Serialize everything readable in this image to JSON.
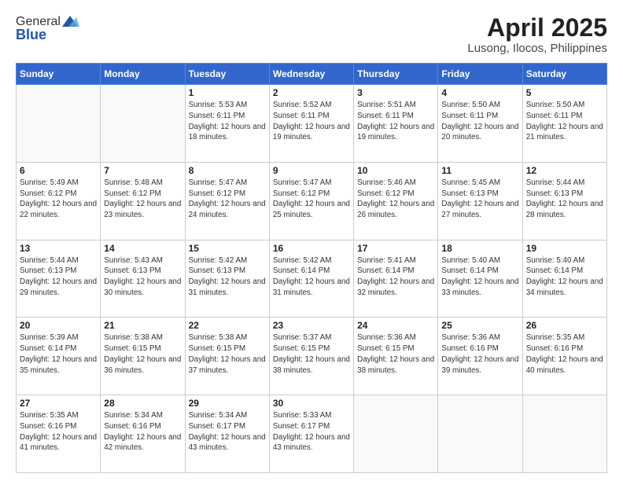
{
  "header": {
    "logo_general": "General",
    "logo_blue": "Blue",
    "title": "April 2025",
    "subtitle": "Lusong, Ilocos, Philippines"
  },
  "weekdays": [
    "Sunday",
    "Monday",
    "Tuesday",
    "Wednesday",
    "Thursday",
    "Friday",
    "Saturday"
  ],
  "weeks": [
    [
      {
        "day": "",
        "info": ""
      },
      {
        "day": "",
        "info": ""
      },
      {
        "day": "1",
        "info": "Sunrise: 5:53 AM\nSunset: 6:11 PM\nDaylight: 12 hours and 18 minutes."
      },
      {
        "day": "2",
        "info": "Sunrise: 5:52 AM\nSunset: 6:11 PM\nDaylight: 12 hours and 19 minutes."
      },
      {
        "day": "3",
        "info": "Sunrise: 5:51 AM\nSunset: 6:11 PM\nDaylight: 12 hours and 19 minutes."
      },
      {
        "day": "4",
        "info": "Sunrise: 5:50 AM\nSunset: 6:11 PM\nDaylight: 12 hours and 20 minutes."
      },
      {
        "day": "5",
        "info": "Sunrise: 5:50 AM\nSunset: 6:11 PM\nDaylight: 12 hours and 21 minutes."
      }
    ],
    [
      {
        "day": "6",
        "info": "Sunrise: 5:49 AM\nSunset: 6:12 PM\nDaylight: 12 hours and 22 minutes."
      },
      {
        "day": "7",
        "info": "Sunrise: 5:48 AM\nSunset: 6:12 PM\nDaylight: 12 hours and 23 minutes."
      },
      {
        "day": "8",
        "info": "Sunrise: 5:47 AM\nSunset: 6:12 PM\nDaylight: 12 hours and 24 minutes."
      },
      {
        "day": "9",
        "info": "Sunrise: 5:47 AM\nSunset: 6:12 PM\nDaylight: 12 hours and 25 minutes."
      },
      {
        "day": "10",
        "info": "Sunrise: 5:46 AM\nSunset: 6:12 PM\nDaylight: 12 hours and 26 minutes."
      },
      {
        "day": "11",
        "info": "Sunrise: 5:45 AM\nSunset: 6:13 PM\nDaylight: 12 hours and 27 minutes."
      },
      {
        "day": "12",
        "info": "Sunrise: 5:44 AM\nSunset: 6:13 PM\nDaylight: 12 hours and 28 minutes."
      }
    ],
    [
      {
        "day": "13",
        "info": "Sunrise: 5:44 AM\nSunset: 6:13 PM\nDaylight: 12 hours and 29 minutes."
      },
      {
        "day": "14",
        "info": "Sunrise: 5:43 AM\nSunset: 6:13 PM\nDaylight: 12 hours and 30 minutes."
      },
      {
        "day": "15",
        "info": "Sunrise: 5:42 AM\nSunset: 6:13 PM\nDaylight: 12 hours and 31 minutes."
      },
      {
        "day": "16",
        "info": "Sunrise: 5:42 AM\nSunset: 6:14 PM\nDaylight: 12 hours and 31 minutes."
      },
      {
        "day": "17",
        "info": "Sunrise: 5:41 AM\nSunset: 6:14 PM\nDaylight: 12 hours and 32 minutes."
      },
      {
        "day": "18",
        "info": "Sunrise: 5:40 AM\nSunset: 6:14 PM\nDaylight: 12 hours and 33 minutes."
      },
      {
        "day": "19",
        "info": "Sunrise: 5:40 AM\nSunset: 6:14 PM\nDaylight: 12 hours and 34 minutes."
      }
    ],
    [
      {
        "day": "20",
        "info": "Sunrise: 5:39 AM\nSunset: 6:14 PM\nDaylight: 12 hours and 35 minutes."
      },
      {
        "day": "21",
        "info": "Sunrise: 5:38 AM\nSunset: 6:15 PM\nDaylight: 12 hours and 36 minutes."
      },
      {
        "day": "22",
        "info": "Sunrise: 5:38 AM\nSunset: 6:15 PM\nDaylight: 12 hours and 37 minutes."
      },
      {
        "day": "23",
        "info": "Sunrise: 5:37 AM\nSunset: 6:15 PM\nDaylight: 12 hours and 38 minutes."
      },
      {
        "day": "24",
        "info": "Sunrise: 5:36 AM\nSunset: 6:15 PM\nDaylight: 12 hours and 38 minutes."
      },
      {
        "day": "25",
        "info": "Sunrise: 5:36 AM\nSunset: 6:16 PM\nDaylight: 12 hours and 39 minutes."
      },
      {
        "day": "26",
        "info": "Sunrise: 5:35 AM\nSunset: 6:16 PM\nDaylight: 12 hours and 40 minutes."
      }
    ],
    [
      {
        "day": "27",
        "info": "Sunrise: 5:35 AM\nSunset: 6:16 PM\nDaylight: 12 hours and 41 minutes."
      },
      {
        "day": "28",
        "info": "Sunrise: 5:34 AM\nSunset: 6:16 PM\nDaylight: 12 hours and 42 minutes."
      },
      {
        "day": "29",
        "info": "Sunrise: 5:34 AM\nSunset: 6:17 PM\nDaylight: 12 hours and 43 minutes."
      },
      {
        "day": "30",
        "info": "Sunrise: 5:33 AM\nSunset: 6:17 PM\nDaylight: 12 hours and 43 minutes."
      },
      {
        "day": "",
        "info": ""
      },
      {
        "day": "",
        "info": ""
      },
      {
        "day": "",
        "info": ""
      }
    ]
  ]
}
